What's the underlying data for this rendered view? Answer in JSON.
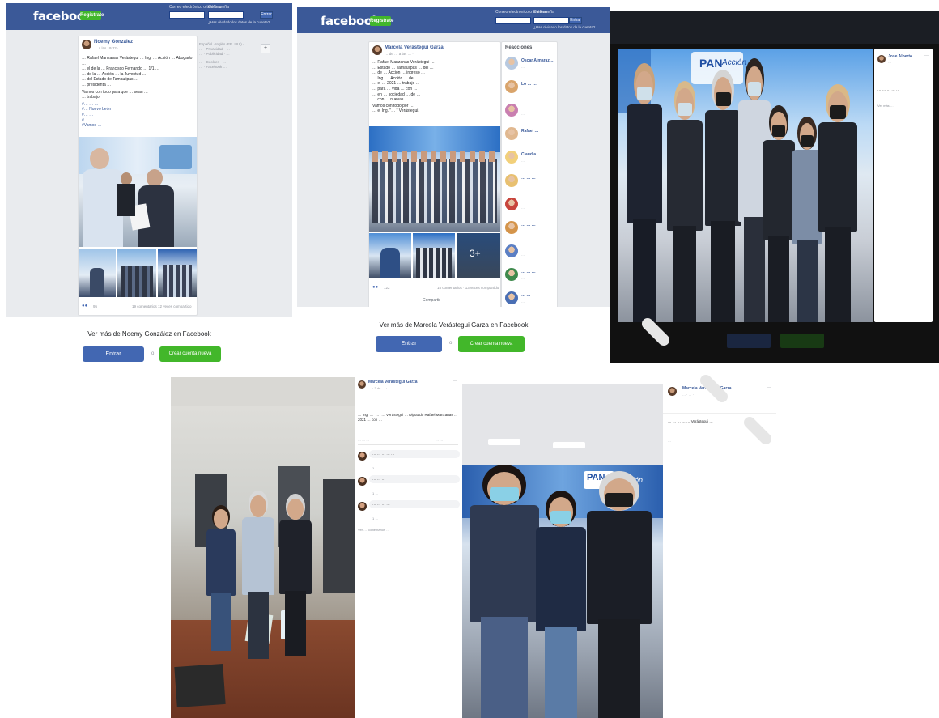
{
  "panel1": {
    "brand": "facebook",
    "signup_label": "Regístrate",
    "login": {
      "email_label": "Correo electrónico o teléfono",
      "password_label": "Contraseña",
      "login_button": "Entrar",
      "forgot_link": "¿Has olvidado los datos de la cuenta?"
    },
    "post": {
      "author": "Noemy González",
      "timestamp": "… a las 19:22 · …",
      "body_lines": [
        "… Rafael Manzanas Verástegui … Ing. … Acción … Abogado …",
        "… el de la … Francisco Fernando … 1/1 …",
        "… de la … Acción … la Juventud …",
        "… del Estado de Tamaulipas …",
        "… presidenta …",
        "Vamos con todo para que … sean …",
        "… trabajo."
      ],
      "tags": [
        "#… … …",
        "#… Nuevo León",
        "#… …",
        "#… …",
        "#Vamos …"
      ],
      "reactions_count": "95",
      "stats": "19 comentarios 12 veces compartido"
    },
    "sidebar": {
      "lines": [
        "Español · Inglés (EE. UU.) · …",
        "… · Privacidad · …",
        "… · Publicidad · …",
        "… · Cookies · …",
        "… · Facebook …"
      ],
      "more_icon": "+"
    },
    "banner": {
      "title": "Ver más de Noemy González en Facebook",
      "login": "Entrar",
      "or": "o",
      "create": "Crear cuenta nueva"
    }
  },
  "panel2": {
    "brand": "facebook",
    "signup_label": "Regístrate",
    "login": {
      "email_label": "Correo electrónico o teléfono",
      "password_label": "Contraseña",
      "login_button": "Entrar",
      "forgot_link": "¿Has olvidado los datos de la cuenta?"
    },
    "post": {
      "author": "Marcela Verástegui Garza",
      "timestamp": "… de … a las … ·",
      "body_lines": [
        "… Rafael Manzanas Verástegui …",
        "… Estado … Tamaulipas … del …",
        "… de … Acción … ingreso …",
        "… Ing. … Acción … de …",
        "… el … 2021 … trabajo …",
        "… para … vida … con …",
        "… en … sociedad … de …",
        "… con … nuevas …",
        "Vamos con todo por …",
        "… el Ing. \"… \" Verástegui."
      ],
      "photo_more": "3+",
      "reactions_count": "122",
      "stats": "15 comentarios · 13 veces compartido",
      "share_label": "Compartir"
    },
    "sidebar": {
      "title": "Reacciones",
      "people": [
        {
          "name": "Oscar Almaraz …",
          "sub": "…"
        },
        {
          "name": "Lo … …",
          "sub": "…"
        },
        {
          "name": "… …",
          "sub": "…"
        },
        {
          "name": "Rafael …",
          "sub": "…"
        },
        {
          "name": "Claudia … …",
          "sub": "…"
        },
        {
          "name": "… … …",
          "sub": "…"
        },
        {
          "name": "… … …",
          "sub": "…"
        },
        {
          "name": "… … …",
          "sub": "…"
        },
        {
          "name": "… … …",
          "sub": "…"
        },
        {
          "name": "… … …",
          "sub": "…"
        },
        {
          "name": "… …",
          "sub": "…"
        }
      ]
    },
    "banner": {
      "title": "Ver más de Marcela Verástegui Garza en Facebook",
      "login": "Entrar",
      "or": "o",
      "create": "Crear cuenta nueva"
    }
  },
  "panel3": {
    "author": "Jose Alberto …",
    "meta": "… ·",
    "text": "… … … … …",
    "more": "Ver más …",
    "sign_label": "PAN",
    "sign_word": "Acción"
  },
  "panel4": {
    "author": "Marcela Verástegui Garza",
    "meta": "… · 3 de … ·",
    "text": "… Ing. … \"…\" … Verástegui … Diputado Rafael Manzanas … 2021 … con …",
    "stats_left": "… … …",
    "stats_right": "… …",
    "comments": [
      {
        "text": "… … … … …",
        "like": "1 …"
      },
      {
        "text": "… … …",
        "like": "1 …"
      },
      {
        "text": "… … … …",
        "like": "1 …"
      }
    ],
    "more_comments": "Ver … comentarios …"
  },
  "panel5": {
    "author": "Marcela Verástegui Garza",
    "meta": "… · … ·",
    "text": "… … … … … Verástegui …",
    "stats": "…",
    "sign_label": "PAN",
    "sign_word": "Acción"
  },
  "colors": {
    "fb_blue": "#3b5998",
    "fb_button_blue": "#4267b2",
    "fb_green": "#42b72a",
    "watermark": "#e6e6e6"
  }
}
